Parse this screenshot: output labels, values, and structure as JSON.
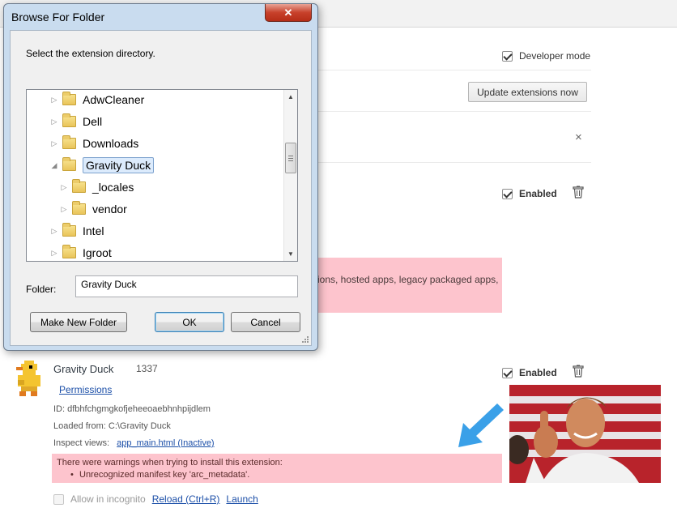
{
  "page": {
    "developer_mode_label": "Developer mode",
    "update_button": "Update extensions now",
    "close_glyph": "×",
    "enabled_label": "Enabled",
    "partial_warning": "ions, hosted apps, legacy packaged apps,"
  },
  "extension": {
    "name": "Gravity Duck",
    "version": "1337",
    "permissions_link": "Permissions",
    "id_line": "ID: dfbhfchgmgkofjeheeoaebhnhpijdlem",
    "loaded_from": "Loaded from: C:\\Gravity Duck",
    "inspect_label": "Inspect views:",
    "inspect_link": "app_main.html (Inactive)",
    "warning_title": "There were warnings when trying to install this extension:",
    "warning_item": "Unrecognized manifest key 'arc_metadata'.",
    "incognito_label": "Allow in incognito",
    "reload_link": "Reload (Ctrl+R)",
    "launch_link": "Launch"
  },
  "dialog": {
    "title": "Browse For Folder",
    "close_glyph": "✕",
    "prompt": "Select the extension directory.",
    "tree": [
      {
        "label": "AdwCleaner",
        "expander": "▷",
        "depth": 0,
        "selected": false
      },
      {
        "label": "Dell",
        "expander": "▷",
        "depth": 0,
        "selected": false
      },
      {
        "label": "Downloads",
        "expander": "▷",
        "depth": 0,
        "selected": false
      },
      {
        "label": "Gravity Duck",
        "expander": "◢",
        "depth": 0,
        "selected": true
      },
      {
        "label": "_locales",
        "expander": "▷",
        "depth": 1,
        "selected": false
      },
      {
        "label": "vendor",
        "expander": "▷",
        "depth": 1,
        "selected": false
      },
      {
        "label": "Intel",
        "expander": "▷",
        "depth": 0,
        "selected": false
      },
      {
        "label": "Igroot",
        "expander": "▷",
        "depth": 0,
        "selected": false
      }
    ],
    "folder_label": "Folder:",
    "folder_value": "Gravity Duck",
    "make_new_folder": "Make New Folder",
    "ok": "OK",
    "cancel": "Cancel"
  },
  "colors": {
    "warning_bg": "#fdc4cd",
    "link": "#1c4fa8",
    "arrow": "#3aa0e8"
  }
}
